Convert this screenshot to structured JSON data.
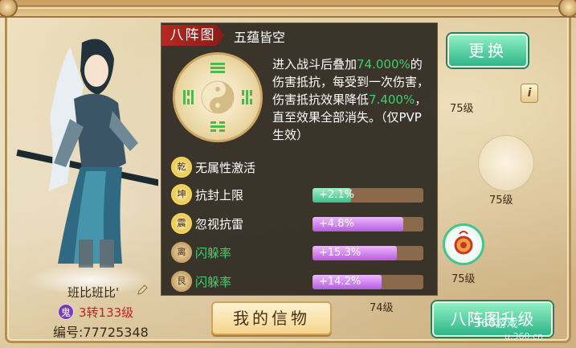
{
  "character": {
    "name": "班比班比'",
    "badge": "鬼",
    "level": "3转133级",
    "id_label": "编号:77725348"
  },
  "tooltip": {
    "tag": "八阵图",
    "subtitle": "五蕴皆空",
    "desc_1": "进入战斗后叠加",
    "desc_hl_1": "74.000%",
    "desc_2": "的伤害抵抗，每受到一次伤害，伤害抵抗效果降低",
    "desc_hl_2": "7.400%",
    "desc_3": "，直至效果全部消失。（仅PVP生效）",
    "stats": [
      {
        "badge": "乾",
        "label": "无属性激活",
        "label_color": "white",
        "value": "",
        "fill": 0,
        "bar": "none",
        "active": true
      },
      {
        "badge": "坤",
        "label": "抗封上限",
        "label_color": "white",
        "value": "+2.1%",
        "fill": 0.35,
        "bar": "green",
        "active": true
      },
      {
        "badge": "震",
        "label": "忽视抗雷",
        "label_color": "white",
        "value": "+4.8%",
        "fill": 0.82,
        "bar": "purple",
        "active": true
      },
      {
        "badge": "离",
        "label": "闪躲率",
        "label_color": "green",
        "value": "+15.3%",
        "fill": 0.76,
        "bar": "purple",
        "active": false
      },
      {
        "badge": "艮",
        "label": "闪躲率",
        "label_color": "green",
        "value": "+14.2%",
        "fill": 0.62,
        "bar": "purple",
        "active": false
      }
    ]
  },
  "buttons": {
    "change": "更换",
    "my_token": "我的信物",
    "upgrade": "八阵图升级"
  },
  "levels": {
    "slot_a": "75级",
    "slot_b": "75级",
    "slot_c": "75级",
    "slot_d": "74级",
    "slot_e": "71级"
  },
  "watermark": {
    "brand": "360游戏",
    "url": "u.360.cn"
  },
  "colors": {
    "tag_red": "#b52a22",
    "highlight_green": "#3ed06b",
    "level_red": "#c81e1e"
  }
}
